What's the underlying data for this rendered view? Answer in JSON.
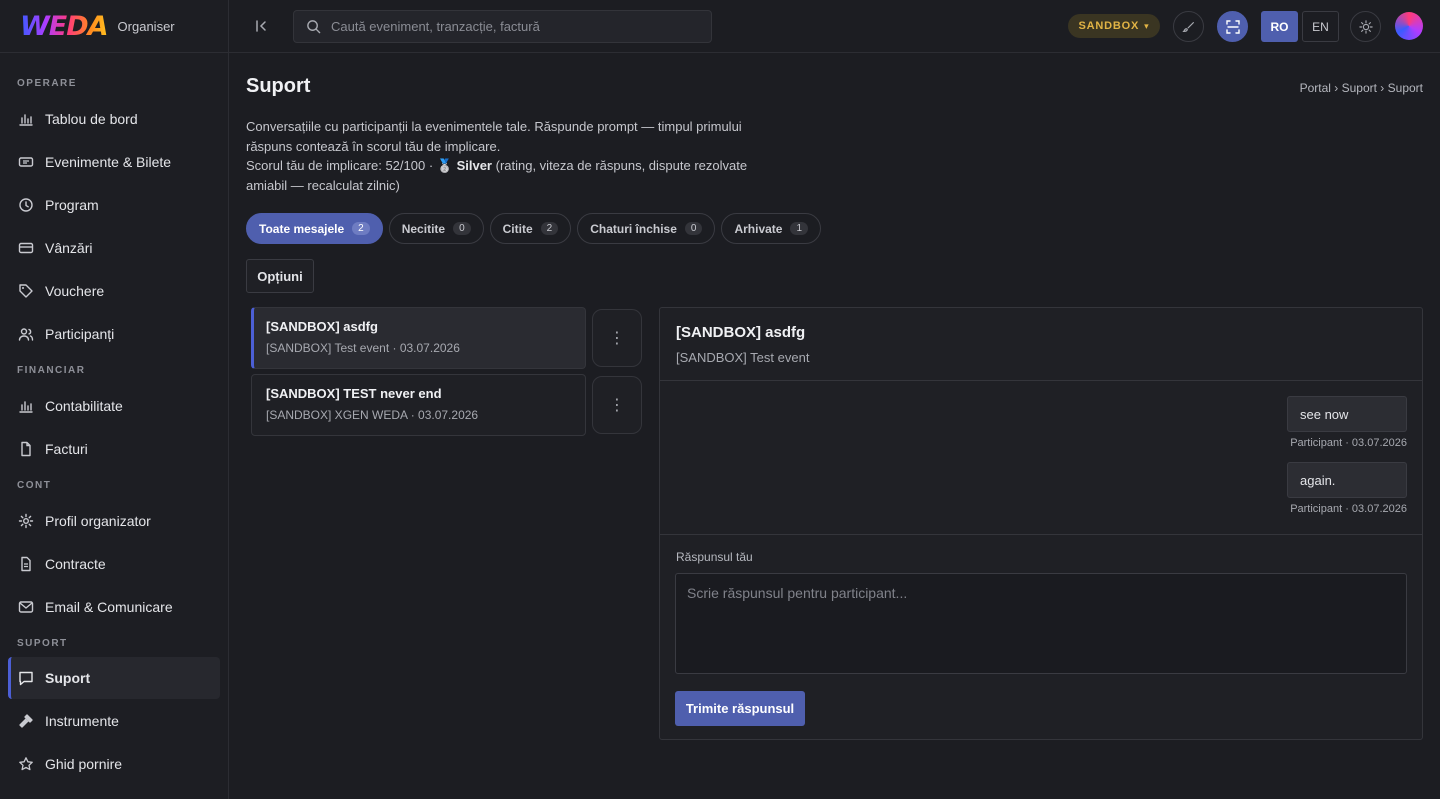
{
  "brand": {
    "logo": "WEDA",
    "subtitle": "Organiser"
  },
  "sidebar": {
    "sections": [
      {
        "title": "OPERARE",
        "items": [
          {
            "label": "Tablou de bord",
            "icon": "bar-chart-icon"
          },
          {
            "label": "Evenimente & Bilete",
            "icon": "ticket-icon"
          },
          {
            "label": "Program",
            "icon": "clock-icon"
          },
          {
            "label": "Vânzări",
            "icon": "credit-card-icon"
          },
          {
            "label": "Vouchere",
            "icon": "tag-icon"
          },
          {
            "label": "Participanți",
            "icon": "users-icon"
          }
        ]
      },
      {
        "title": "FINANCIAR",
        "items": [
          {
            "label": "Contabilitate",
            "icon": "bar-chart-icon"
          },
          {
            "label": "Facturi",
            "icon": "file-icon"
          }
        ]
      },
      {
        "title": "CONT",
        "items": [
          {
            "label": "Profil organizator",
            "icon": "gear-icon"
          },
          {
            "label": "Contracte",
            "icon": "document-icon"
          },
          {
            "label": "Email & Comunicare",
            "icon": "mail-icon"
          }
        ]
      },
      {
        "title": "SUPORT",
        "items": [
          {
            "label": "Suport",
            "icon": "chat-icon",
            "active": true
          },
          {
            "label": "Instrumente",
            "icon": "hammer-icon"
          },
          {
            "label": "Ghid pornire",
            "icon": "star-icon"
          }
        ]
      }
    ]
  },
  "topbar": {
    "search_placeholder": "Caută eveniment, tranzacție, factură",
    "environment": "SANDBOX",
    "lang_ro": "RO",
    "lang_en": "EN"
  },
  "page": {
    "title": "Suport",
    "breadcrumb": "Portal › Suport › Suport",
    "description_line1": "Conversațiile cu participanții la evenimentele tale. Răspunde prompt — timpul primului răspuns contează în scorul tău de implicare.",
    "score_prefix": "Scorul tău de implicare: 52/100 · 🥈 ",
    "score_tier": "Silver",
    "score_suffix": " (rating, viteza de răspuns, dispute rezolvate amiabil — recalculat zilnic)"
  },
  "tabs": [
    {
      "label": "Toate mesajele",
      "count": "2",
      "active": true
    },
    {
      "label": "Necitite",
      "count": "0"
    },
    {
      "label": "Citite",
      "count": "2"
    },
    {
      "label": "Chaturi închise",
      "count": "0"
    },
    {
      "label": "Arhivate",
      "count": "1"
    }
  ],
  "options_label": "Opțiuni",
  "conversations": [
    {
      "title": "[SANDBOX] asdfg",
      "subtitle": "[SANDBOX] Test event · 03.07.2026",
      "selected": true
    },
    {
      "title": "[SANDBOX] TEST never end",
      "subtitle": "[SANDBOX] XGEN WEDA · 03.07.2026"
    }
  ],
  "detail": {
    "title": "[SANDBOX] asdfg",
    "subtitle": "[SANDBOX] Test event",
    "messages": [
      {
        "text": "see now",
        "meta": "Participant · 03.07.2026"
      },
      {
        "text": "again.",
        "meta": "Participant · 03.07.2026"
      }
    ],
    "reply_label": "Răspunsul tău",
    "reply_placeholder": "Scrie răspunsul pentru participant...",
    "send_label": "Trimite răspunsul"
  }
}
